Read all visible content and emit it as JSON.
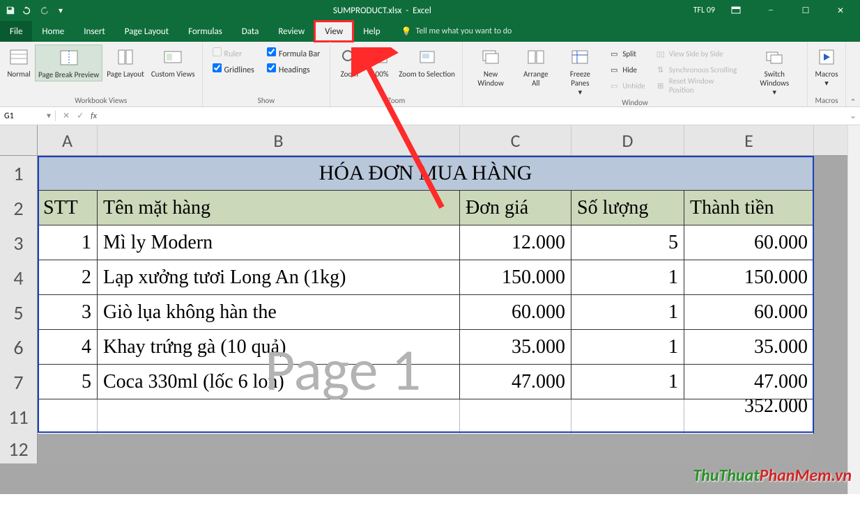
{
  "title": {
    "filename": "SUMPRODUCT.xlsx",
    "app": "Excel",
    "user": "TFL 09"
  },
  "tabs": {
    "file": "File",
    "home": "Home",
    "insert": "Insert",
    "pagelayout": "Page Layout",
    "formulas": "Formulas",
    "data": "Data",
    "review": "Review",
    "view": "View",
    "help": "Help",
    "tellme": "Tell me what you want to do"
  },
  "ribbon": {
    "views": {
      "normal": "Normal",
      "pagebreak": "Page Break Preview",
      "pagelayout": "Page Layout",
      "custom": "Custom Views",
      "group": "Workbook Views"
    },
    "show": {
      "ruler": "Ruler",
      "formulabar": "Formula Bar",
      "gridlines": "Gridlines",
      "headings": "Headings",
      "group": "Show"
    },
    "zoom": {
      "zoom": "Zoom",
      "z100": "100%",
      "zsel": "Zoom to Selection",
      "group": "Zoom"
    },
    "window": {
      "neww": "New Window",
      "arrange": "Arrange All",
      "freeze": "Freeze Panes",
      "split": "Split",
      "hide": "Hide",
      "unhide": "Unhide",
      "sidebyside": "View Side by Side",
      "syncscroll": "Synchronous Scrolling",
      "resetpos": "Reset Window Position",
      "switch": "Switch Windows",
      "group": "Window"
    },
    "macros": {
      "macros": "Macros",
      "group": "Macros"
    }
  },
  "fx": {
    "namebox": "G1",
    "fxsymbol": "fx"
  },
  "cols": {
    "A": "A",
    "B": "B",
    "C": "C",
    "D": "D",
    "E": "E"
  },
  "rows": {
    "r1": "1",
    "r2": "2",
    "r3": "3",
    "r4": "4",
    "r5": "5",
    "r6": "6",
    "r7": "7",
    "r11": "11",
    "r12": "12"
  },
  "sheet": {
    "title": "HÓA ĐƠN MUA HÀNG",
    "head": {
      "stt": "STT",
      "ten": "Tên mặt hàng",
      "dongia": "Đơn giá",
      "soluong": "Số lượng",
      "thanhtien": "Thành tiền"
    },
    "rows": [
      {
        "stt": "1",
        "ten": "Mì ly Modern",
        "dongia": "12.000",
        "soluong": "5",
        "thanhtien": "60.000"
      },
      {
        "stt": "2",
        "ten": "Lạp xưởng tươi Long An (1kg)",
        "dongia": "150.000",
        "soluong": "1",
        "thanhtien": "150.000"
      },
      {
        "stt": "3",
        "ten": "Giò lụa không hàn the",
        "dongia": "60.000",
        "soluong": "1",
        "thanhtien": "60.000"
      },
      {
        "stt": "4",
        "ten": "Khay trứng gà (10 quả)",
        "dongia": "35.000",
        "soluong": "1",
        "thanhtien": "35.000"
      },
      {
        "stt": "5",
        "ten": "Coca 330ml (lốc 6 lon)",
        "dongia": "47.000",
        "soluong": "1",
        "thanhtien": "47.000"
      }
    ],
    "total": "352.000",
    "watermark": "Page 1"
  },
  "brand": {
    "a": "ThuThuat",
    "b": "PhanMem.vn"
  }
}
